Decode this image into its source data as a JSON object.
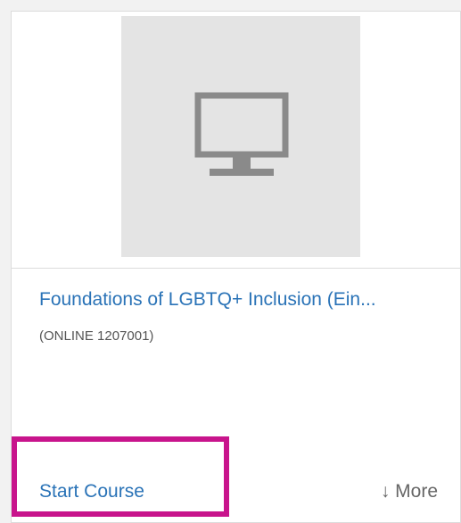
{
  "course": {
    "title": "Foundations of LGBTQ+ Inclusion (Ein...",
    "code": "(ONLINE 1207001)",
    "thumbnail_icon": "monitor-icon"
  },
  "actions": {
    "start_label": "Start Course",
    "more_label": "↓ More"
  },
  "colors": {
    "link": "#2a73b7",
    "highlight": "#c8148c",
    "thumbnail_bg": "#e4e4e4"
  }
}
